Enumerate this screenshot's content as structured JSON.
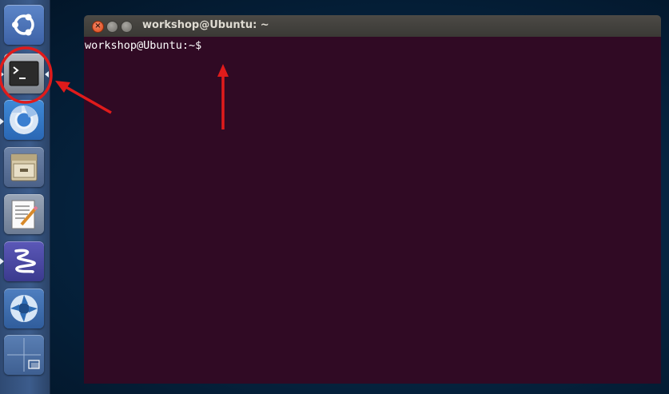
{
  "window": {
    "title": "workshop@Ubuntu: ~",
    "close_symbol": "×"
  },
  "terminal": {
    "prompt": "workshop@Ubuntu:~$"
  },
  "launcher": {
    "items": [
      {
        "name": "dash-home",
        "icon": "ubuntu-logo-icon"
      },
      {
        "name": "terminal",
        "icon": "terminal-icon",
        "running": true,
        "active": true
      },
      {
        "name": "chromium",
        "icon": "chromium-icon",
        "running": true
      },
      {
        "name": "files",
        "icon": "file-cabinet-icon"
      },
      {
        "name": "text-editor",
        "icon": "text-editor-icon"
      },
      {
        "name": "emacs",
        "icon": "emacs-icon",
        "running": true
      },
      {
        "name": "screenshot",
        "icon": "aperture-icon"
      },
      {
        "name": "workspace-switcher",
        "icon": "workspace-switcher-icon"
      }
    ]
  },
  "annotations": {
    "color": "#e01b1b"
  },
  "colors": {
    "terminal_bg": "#300a24",
    "titlebar": "#3c3b37",
    "close_button": "#dd4814"
  }
}
